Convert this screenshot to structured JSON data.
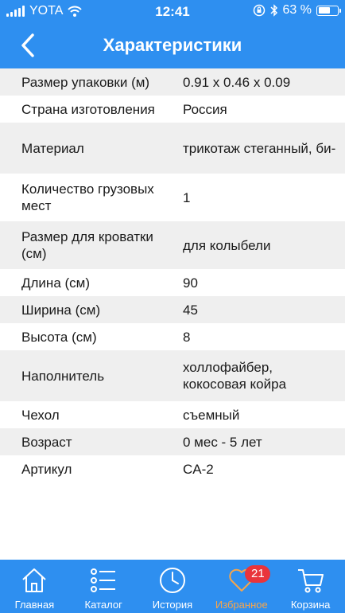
{
  "status_bar": {
    "carrier": "YOTA",
    "time": "12:41",
    "battery_percent": "63 %",
    "battery_level": 0.63
  },
  "header": {
    "title": "Характеристики",
    "back_icon": "chevron-left-icon"
  },
  "specs": [
    {
      "label": "Размер упаковки (м)",
      "value": "0.91 x 0.46 x 0.09"
    },
    {
      "label": "Страна изготовления",
      "value": "Россия"
    },
    {
      "label": "Материал",
      "value": "трикотаж стеганный, би-"
    },
    {
      "label": "Количество грузовых мест",
      "value": "1"
    },
    {
      "label": "Размер для кроватки (см)",
      "value": "для колыбели"
    },
    {
      "label": "Длина (см)",
      "value": "90"
    },
    {
      "label": "Ширина (см)",
      "value": "45"
    },
    {
      "label": "Высота (см)",
      "value": "8"
    },
    {
      "label": "Наполнитель",
      "value": "холлофайбер, кокосовая койра"
    },
    {
      "label": "Чехол",
      "value": "съемный"
    },
    {
      "label": "Возраст",
      "value": "0 мес - 5 лет"
    },
    {
      "label": "Артикул",
      "value": "CA-2"
    }
  ],
  "tabbar": {
    "tabs": [
      {
        "label": "Главная",
        "icon": "home-icon"
      },
      {
        "label": "Каталог",
        "icon": "list-icon"
      },
      {
        "label": "История",
        "icon": "clock-icon"
      },
      {
        "label": "Избранное",
        "icon": "heart-icon",
        "badge": "21",
        "active": true
      },
      {
        "label": "Корзина",
        "icon": "cart-icon"
      }
    ]
  },
  "colors": {
    "accent": "#2e8ff0",
    "active_tab": "#f7a54a",
    "badge": "#e9343b",
    "row_stripe": "#efefef"
  }
}
